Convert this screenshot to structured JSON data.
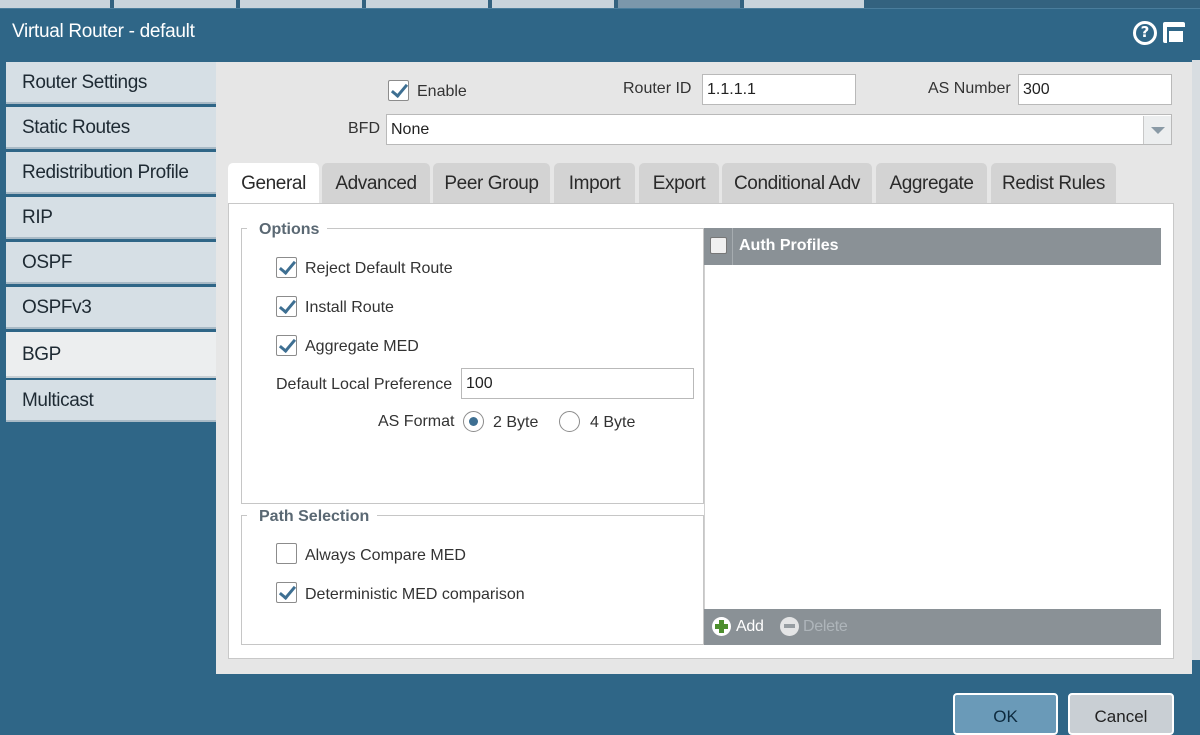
{
  "window": {
    "title": "Virtual Router - default"
  },
  "nav": {
    "items": [
      {
        "label": "Router Settings"
      },
      {
        "label": "Static Routes"
      },
      {
        "label": "Redistribution Profile"
      },
      {
        "label": "RIP"
      },
      {
        "label": "OSPF"
      },
      {
        "label": "OSPFv3"
      },
      {
        "label": "BGP",
        "active": true
      },
      {
        "label": "Multicast"
      }
    ]
  },
  "bgp": {
    "enable_label": "Enable",
    "enable_checked": true,
    "router_id_label": "Router ID",
    "router_id_value": "1.1.1.1",
    "as_number_label": "AS Number",
    "as_number_value": "300",
    "bfd_label": "BFD",
    "bfd_value": "None"
  },
  "tabs": [
    {
      "label": "General",
      "active": true
    },
    {
      "label": "Advanced"
    },
    {
      "label": "Peer Group"
    },
    {
      "label": "Import"
    },
    {
      "label": "Export"
    },
    {
      "label": "Conditional Adv"
    },
    {
      "label": "Aggregate"
    },
    {
      "label": "Redist Rules"
    }
  ],
  "options": {
    "title": "Options",
    "reject_default_route": {
      "label": "Reject Default Route",
      "checked": true
    },
    "install_route": {
      "label": "Install Route",
      "checked": true
    },
    "aggregate_med": {
      "label": "Aggregate MED",
      "checked": true
    },
    "default_local_pref_label": "Default Local Preference",
    "default_local_pref_value": "100",
    "as_format_label": "AS Format",
    "as_format_2byte": "2 Byte",
    "as_format_4byte": "4 Byte",
    "as_format_selected": "2 Byte"
  },
  "path_selection": {
    "title": "Path Selection",
    "always_compare_med": {
      "label": "Always Compare MED",
      "checked": false
    },
    "deterministic_med": {
      "label": "Deterministic MED comparison",
      "checked": true
    }
  },
  "auth_profiles": {
    "header": "Auth Profiles",
    "add_label": "Add",
    "delete_label": "Delete"
  },
  "footer": {
    "ok_label": "OK",
    "cancel_label": "Cancel"
  },
  "colors": {
    "frame": "#2f6687",
    "panel": "#e6e6e6",
    "grid_header": "#8a9196",
    "accent": "#3e6f92"
  }
}
